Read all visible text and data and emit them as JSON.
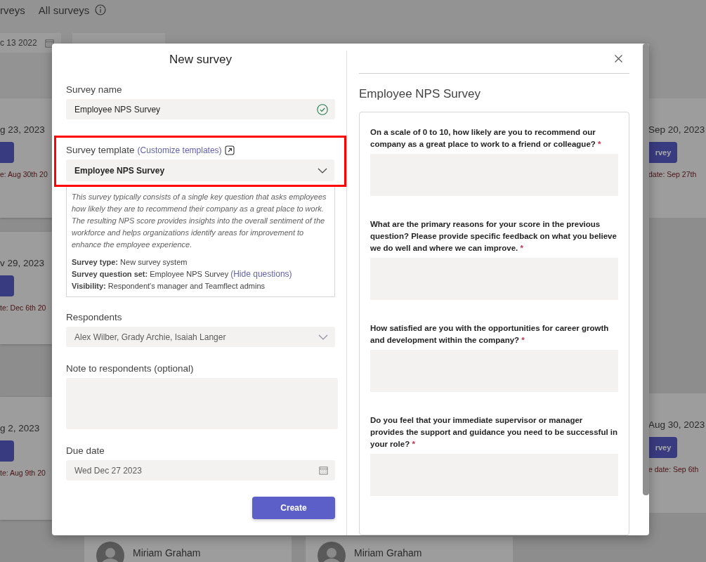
{
  "background": {
    "tabs": [
      "rveys",
      "All surveys"
    ],
    "date_filters": [
      "c 13 2022"
    ],
    "left_cards": [
      {
        "date": "g 23, 2023",
        "due": "e: Aug 30th 20"
      },
      {
        "date": "v 29, 2023",
        "due": "te: Dec 6th 20"
      },
      {
        "date": "g 2, 2023",
        "due": "te: Aug 9th 20"
      }
    ],
    "right_cards": [
      {
        "date": "Sep 20, 2023",
        "button": "rvey",
        "due": "date: Sep 27th"
      },
      {
        "date": "Aug 30, 2023",
        "button": "rvey",
        "due": "e date: Sep 6th"
      }
    ],
    "people": [
      {
        "name": "Miriam Graham"
      },
      {
        "name": "Miriam Graham"
      }
    ]
  },
  "dialog": {
    "title": "New survey",
    "survey_name": {
      "label": "Survey name",
      "value": "Employee NPS Survey",
      "valid": true
    },
    "survey_template": {
      "label": "Survey template",
      "link": "(Customize templates)",
      "value": "Employee NPS Survey",
      "description": "This survey typically consists of a single key question that asks employees how likely they are to recommend their company as a great place to work. The resulting NPS score provides insights into the overall sentiment of the workforce and helps organizations identify areas for improvement to enhance the employee experience.",
      "details": [
        {
          "label": "Survey type:",
          "value": "New survey system"
        },
        {
          "label": "Survey question set:",
          "value": "Employee NPS Survey",
          "link": "(Hide questions)"
        },
        {
          "label": "Visibility:",
          "value": "Respondent's manager and Teamflect admins"
        }
      ]
    },
    "respondents": {
      "label": "Respondents",
      "value": "Alex Wilber, Grady Archie, Isaiah Langer"
    },
    "note": {
      "label": "Note to respondents (optional)"
    },
    "due_date": {
      "label": "Due date",
      "value": "Wed Dec 27 2023"
    },
    "create_button": "Create",
    "preview": {
      "title": "Employee NPS Survey",
      "questions": [
        {
          "text": "On a scale of 0 to 10, how likely are you to recommend our company as a great place to work to a friend or colleague?",
          "required_mark": "*"
        },
        {
          "text": "What are the primary reasons for your score in the previous question? Please provide specific feedback on what you believe we do well and where we can improve.",
          "required_mark": "*"
        },
        {
          "text": "How satisfied are you with the opportunities for career growth and development within the company?",
          "required_mark": "*"
        },
        {
          "text": "Do you feel that your immediate supervisor or manager provides the support and guidance you need to be successful in your role?",
          "required_mark": "*"
        }
      ]
    }
  }
}
